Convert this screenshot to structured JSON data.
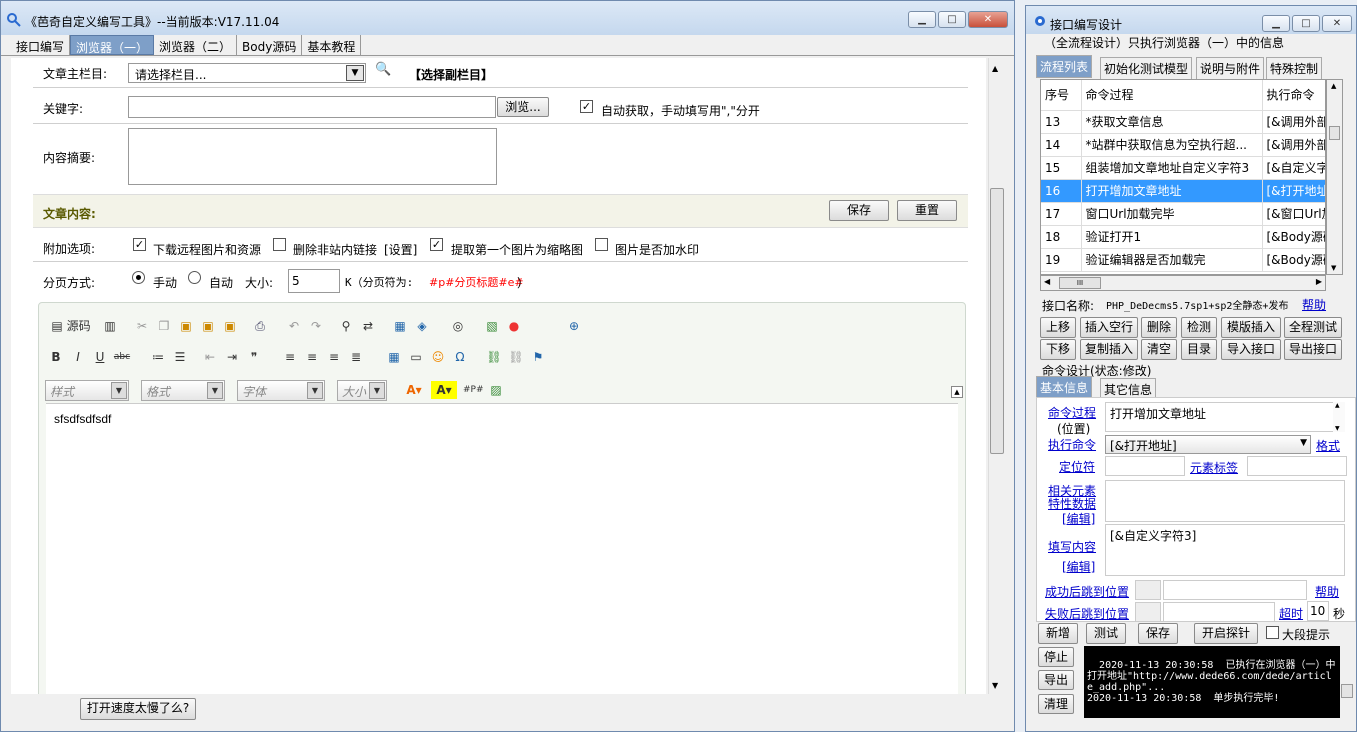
{
  "left": {
    "title": "《芭奇自定义编写工具》--当前版本:V17.11.04",
    "tabs": [
      "接口编写",
      "浏览器（一）",
      "浏览器（二）",
      "Body源码",
      "基本教程"
    ],
    "main_column_label": "文章主栏目:",
    "main_column_select": "请选择栏目...",
    "sub_column_link": "【选择副栏目】",
    "keywords_label": "关键字:",
    "browse_button": "浏览...",
    "auto_fetch_label": "自动获取，手动填写用\",\"分开",
    "summary_label": "内容摘要:",
    "content_label": "文章内容:",
    "save_button": "保存",
    "reset_button": "重置",
    "options_label": "附加选项:",
    "opt_download": "下载远程图片和资源",
    "opt_delete_links": "删除非站内链接",
    "opt_settings": "[设置]",
    "opt_thumb": "提取第一个图片为缩略图",
    "opt_watermark": "图片是否加水印",
    "paging_label": "分页方式:",
    "paging_manual": "手动",
    "paging_auto": "自动",
    "size_label": "大小:",
    "size_value": "5",
    "size_unit": "K（分页符为:",
    "page_marker": "#p#分页标题#e#",
    "page_marker_end": "）",
    "editor": {
      "source": "源码",
      "style": "样式",
      "format": "格式",
      "font": "字体",
      "size": "大小",
      "content": "sfsdfsdfsdf"
    },
    "slow_button": "打开速度太慢了么?"
  },
  "right": {
    "title": "接口编写设计",
    "subtitle": "（全流程设计）只执行浏览器（一）中的信息",
    "tabs": [
      "流程列表",
      "初始化测试模型",
      "说明与附件",
      "特殊控制"
    ],
    "grid_headers": [
      "序号",
      "命令过程",
      "执行命令"
    ],
    "rows": [
      {
        "no": "13",
        "proc": "*获取文章信息",
        "cmd": "[&调用外部"
      },
      {
        "no": "14",
        "proc": "*站群中获取信息为空执行超...",
        "cmd": "[&调用外部"
      },
      {
        "no": "15",
        "proc": "组装增加文章地址自定义字符3",
        "cmd": "[&自定义字"
      },
      {
        "no": "16",
        "proc": "打开增加文章地址",
        "cmd": "[&打开地址"
      },
      {
        "no": "17",
        "proc": "窗口Url加载完毕",
        "cmd": "[&窗口Url加"
      },
      {
        "no": "18",
        "proc": "验证打开1",
        "cmd": "[&Body源码"
      },
      {
        "no": "19",
        "proc": "验证编辑器是否加载完",
        "cmd": "[&Body源码"
      }
    ],
    "hscroll_thumb": "III",
    "iface_label": "接口名称:",
    "iface_value": "PHP_DeDecms5.7sp1+sp2全静态+发布",
    "help": "帮助",
    "btn_row1": [
      "上移",
      "插入空行",
      "删除",
      "检测",
      "模版插入",
      "全程测试"
    ],
    "btn_row2": [
      "下移",
      "复制插入",
      "清空",
      "目录",
      "导入接口",
      "导出接口"
    ],
    "cmd_design": "命令设计(状态:修改)",
    "subtabs": [
      "基本信息",
      "其它信息"
    ],
    "proc_label": "命令过程",
    "proc_pos": "(位置)",
    "proc_value": "打开增加文章地址",
    "exec_label": "执行命令",
    "exec_value": "[&打开地址]",
    "format_link": "格式",
    "locator_label": "定位符",
    "element_tag": "元素标签",
    "related_label": "相关元素",
    "special_label": "特性数据",
    "edit1": "[编辑]",
    "fill_label": "填写内容",
    "fill_value": "[&自定义字符3]",
    "edit2": "[编辑]",
    "success_jump": "成功后跳到位置",
    "fail_jump": "失败后跳到位置",
    "timeout": "超时",
    "timeout_value": "10",
    "seconds": "秒",
    "bottom_btns": [
      "新增",
      "测试",
      "保存",
      "开启探针"
    ],
    "big_hint": "大段提示",
    "side_btns": [
      "停止",
      "导出",
      "清理"
    ],
    "log": "2020-11-13 20:30:58  已执行在浏览器（一）中打开地址\"http://www.dede66.com/dede/article_add.php\"...\n2020-11-13 20:30:58  单步执行完毕!"
  },
  "colors": {
    "accent": "#3399ff",
    "tab_active": "#7e9fc8",
    "marker_red": "#ff0000",
    "content_bar": "#f3f3e8"
  }
}
